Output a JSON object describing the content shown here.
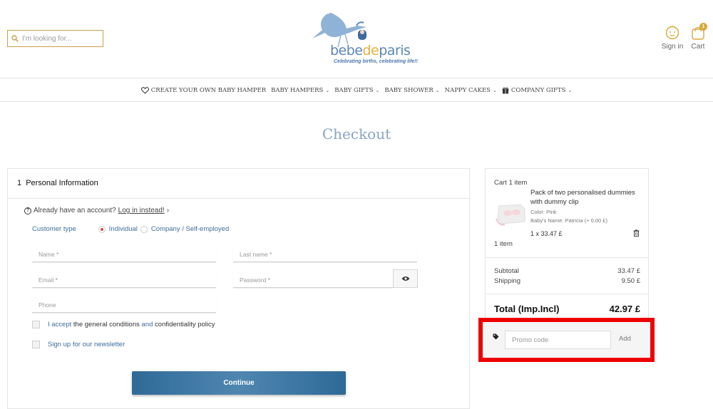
{
  "header": {
    "search_placeholder": "I'm looking for...",
    "logo_left": "bebe",
    "logo_mid": "de",
    "logo_right": "paris",
    "logo_tagline": "Celebrating births, celebrating life!!",
    "signin_label": "Sign in",
    "cart_label": "Cart",
    "cart_badge": "1"
  },
  "nav": {
    "items": [
      {
        "label": "CREATE YOUR OWN BABY HAMPER",
        "icon": "heart-icon"
      },
      {
        "label": "BABY HAMPERS"
      },
      {
        "label": "BABY GIFTS"
      },
      {
        "label": "BABY SHOWER"
      },
      {
        "label": "NAPPY CAKES"
      },
      {
        "label": "COMPANY GIFTS",
        "icon": "gift-icon"
      }
    ]
  },
  "page_title": "Checkout",
  "form": {
    "step_number": "1",
    "step_title": "Personal Information",
    "already_text": "Already have an account?",
    "login_link": "Log in instead!",
    "customer_type_label": "Customer type",
    "option_individual": "Individual",
    "option_company": "Company / Self-employed",
    "name_placeholder": "Name *",
    "lastname_placeholder": "Last name *",
    "email_placeholder": "Email *",
    "password_placeholder": "Password *",
    "phone_placeholder": "Phone",
    "accept_1": "I accept",
    "accept_2": "the general conditions",
    "accept_3": "and",
    "accept_4": "confidentiality policy",
    "newsletter_label": "Sign up for our newsletter",
    "continue_label": "Continue"
  },
  "summary": {
    "cart_count": "Cart 1 item",
    "product_name": "Pack of two personalised dummies with dummy clip",
    "color": "Color: Pink",
    "baby_name": "Baby's Name: Patricia (+ 0.00 £)",
    "qty_price": "1  x 33.47 £",
    "items_line": "1 item",
    "subtotal_label": "Subtotal",
    "subtotal_value": "33.47 £",
    "shipping_label": "Shipping",
    "shipping_value": "9.50 £",
    "total_label": "Total (Imp.Incl)",
    "total_value": "42.97 £"
  },
  "promo": {
    "placeholder": "Promo code",
    "add_label": "Add"
  },
  "colors": {
    "accent_gold": "#c9a24a",
    "brand_blue": "#5a86b5",
    "button_blue": "#2e6a97",
    "highlight_red": "#ee0000"
  }
}
